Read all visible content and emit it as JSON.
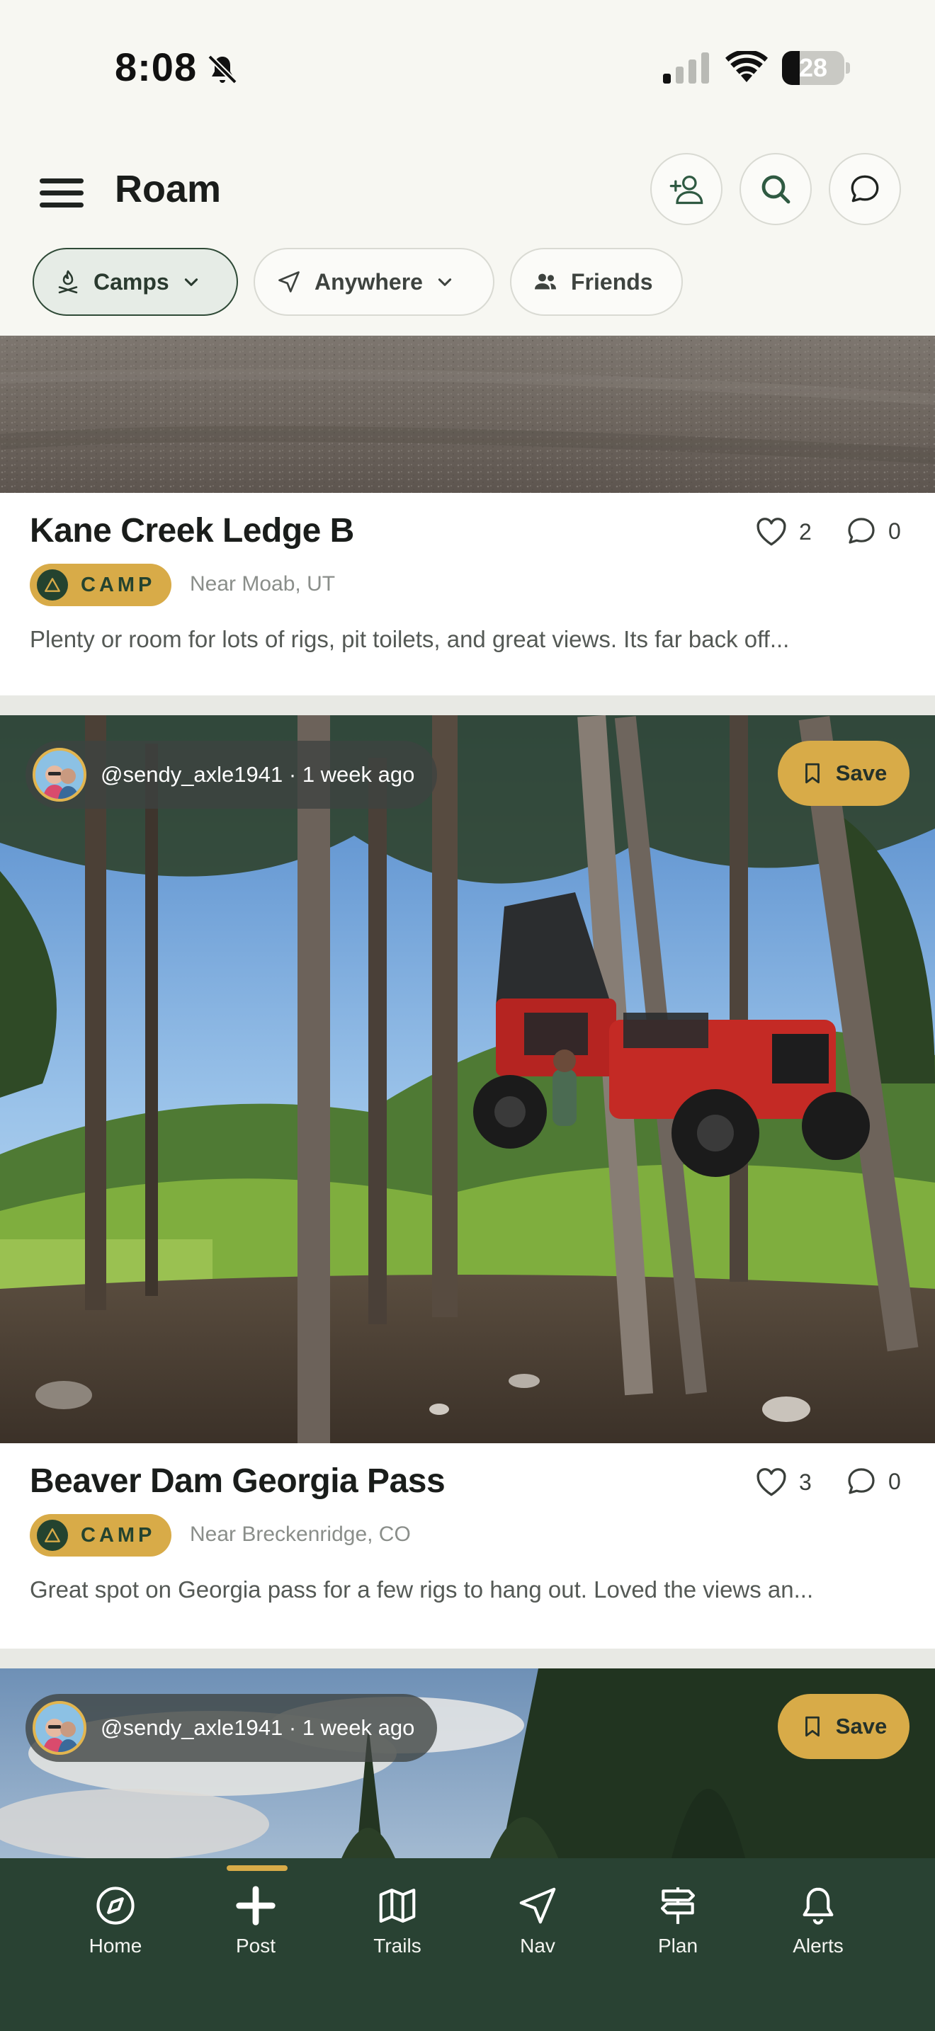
{
  "status_bar": {
    "time": "8:08",
    "battery": "28",
    "battery_level": 0.28,
    "icons": [
      "bell-slash-icon",
      "cellular-signal-icon",
      "wifi-icon",
      "battery-icon"
    ]
  },
  "header": {
    "title": "Roam",
    "icons": [
      "menu-icon",
      "add-friend-icon",
      "search-icon",
      "chat-bubble-icon"
    ],
    "filters": [
      {
        "label": "Camps",
        "icon": "campfire-icon",
        "selected": true
      },
      {
        "label": "Anywhere",
        "icon": "location-arrow-icon",
        "selected": false
      },
      {
        "label": "Friends",
        "icon": "people-icon",
        "selected": false
      }
    ]
  },
  "feed": [
    {
      "title": "Kane Creek Ledge B",
      "likes": "2",
      "comments": "0",
      "badge": "CAMP",
      "location": "Near Moab, UT",
      "description": "Plenty or room for lots of rigs, pit toilets, and great views. Its far back off..."
    },
    {
      "user_meta": "@sendy_axle1941 · 1 week ago",
      "save_label": "Save",
      "title": "Beaver Dam Georgia Pass",
      "likes": "3",
      "comments": "0",
      "badge": "CAMP",
      "location": "Near Breckenridge, CO",
      "description": "Great spot on Georgia pass for a few rigs to hang out. Loved the views an..."
    },
    {
      "user_meta": "@sendy_axle1941 · 1 week ago",
      "save_label": "Save"
    }
  ],
  "tab_bar": {
    "active": "Post",
    "tabs": [
      {
        "label": "Home",
        "icon": "compass-icon"
      },
      {
        "label": "Post",
        "icon": "plus-icon"
      },
      {
        "label": "Trails",
        "icon": "map-icon"
      },
      {
        "label": "Nav",
        "icon": "navigation-arrow-icon"
      },
      {
        "label": "Plan",
        "icon": "signpost-icon"
      },
      {
        "label": "Alerts",
        "icon": "bell-icon"
      }
    ]
  },
  "colors": {
    "background": "#f7f7f2",
    "brand_green": "#294233",
    "accent_gold": "#d8ab48",
    "text_dark": "#1a1d1b",
    "text_muted": "#8a8e8a"
  }
}
